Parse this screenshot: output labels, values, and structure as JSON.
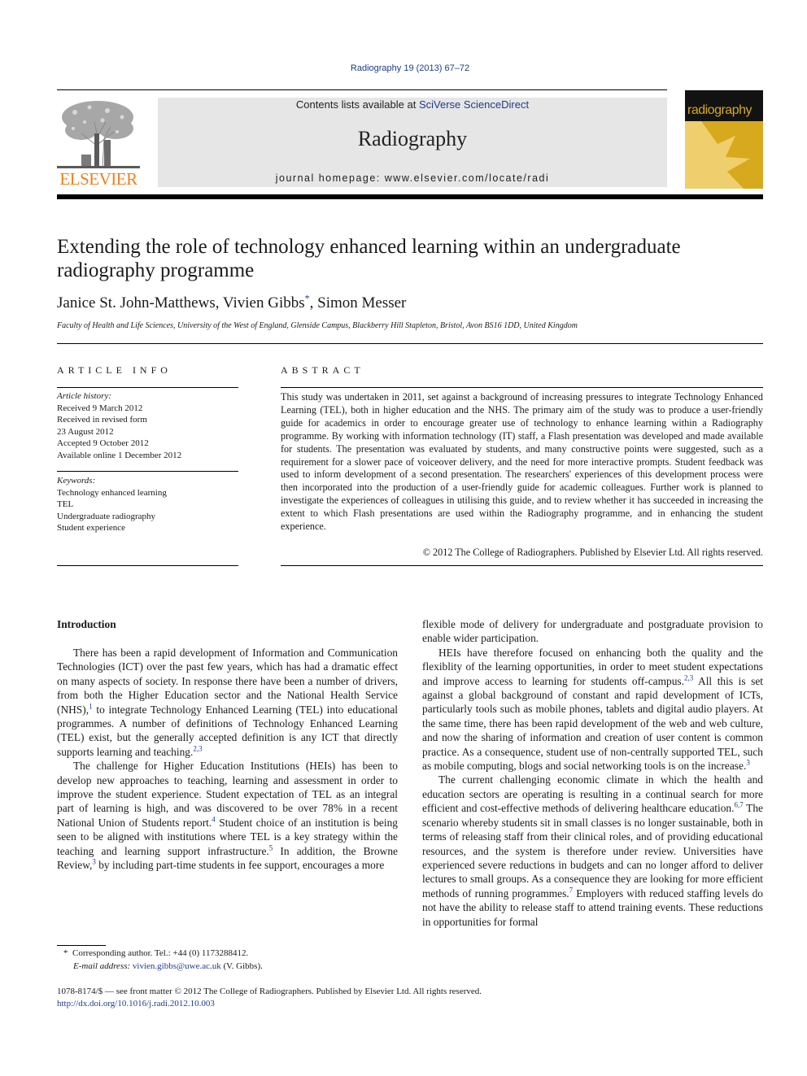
{
  "header": {
    "journal_reference": "Radiography 19 (2013) 67–72",
    "contents_prefix": "Contents lists available at ",
    "contents_link": "SciVerse ScienceDirect",
    "journal_name": "Radiography",
    "homepage_prefix": "journal homepage: ",
    "homepage_url": "www.elsevier.com/locate/radi",
    "publisher_logo_text": "ELSEVIER",
    "cover_title": "radiography",
    "colors": {
      "publisher_orange": "#f07f18",
      "link_blue": "#1f3c88",
      "cover_gold": "#d7a91c",
      "masthead_gray": "#e6e6e6"
    }
  },
  "article": {
    "title": "Extending the role of technology enhanced learning within an undergraduate radiography programme",
    "authors": [
      {
        "name": "Janice St. John-Matthews",
        "mark": ""
      },
      {
        "name": "Vivien Gibbs",
        "mark": "*"
      },
      {
        "name": "Simon Messer",
        "mark": ""
      }
    ],
    "affiliation": "Faculty of Health and Life Sciences, University of the West of England, Glenside Campus, Blackberry Hill Stapleton, Bristol, Avon BS16 1DD, United Kingdom"
  },
  "article_info": {
    "label": "ARTICLE INFO",
    "history_label": "Article history:",
    "history": [
      "Received 9 March 2012",
      "Received in revised form",
      "23 August 2012",
      "Accepted 9 October 2012",
      "Available online 1 December 2012"
    ],
    "keywords_label": "Keywords:",
    "keywords": [
      "Technology enhanced learning",
      "TEL",
      "Undergraduate radiography",
      "Student experience"
    ]
  },
  "abstract": {
    "label": "ABSTRACT",
    "text": "This study was undertaken in 2011, set against a background of increasing pressures to integrate Technology Enhanced Learning (TEL), both in higher education and the NHS. The primary aim of the study was to produce a user-friendly guide for academics in order to encourage greater use of technology to enhance learning within a Radiography programme. By working with information technology (IT) staff, a Flash presentation was developed and made available for students. The presentation was evaluated by students, and many constructive points were suggested, such as a requirement for a slower pace of voiceover delivery, and the need for more interactive prompts. Student feedback was used to inform development of a second presentation. The researchers' experiences of this development process were then incorporated into the production of a user-friendly guide for academic colleagues. Further work is planned to investigate the experiences of colleagues in utilising this guide, and to review whether it has succeeded in increasing the extent to which Flash presentations are used within the Radiography programme, and in enhancing the student experience.",
    "copyright": "© 2012 The College of Radiographers. Published by Elsevier Ltd. All rights reserved."
  },
  "body": {
    "section_heading": "Introduction",
    "left_paragraphs": [
      [
        {
          "t": "There has been a rapid development of Information and Communication Technologies (ICT) over the past few years, which has had a dramatic effect on many aspects of society. In response there have been a number of drivers, from both the Higher Education sector and the National Health Service (NHS),"
        },
        {
          "c": "1"
        },
        {
          "t": " to integrate Technology Enhanced Learning (TEL) into educational programmes. A number of definitions of Technology Enhanced Learning (TEL) exist, but the generally accepted definition is any ICT that directly supports learning and teaching."
        },
        {
          "c": "2,3"
        }
      ],
      [
        {
          "t": "The challenge for Higher Education Institutions (HEIs) has been to develop new approaches to teaching, learning and assessment in order to improve the student experience. Student expectation of TEL as an integral part of learning is high, and was discovered to be over 78% in a recent National Union of Students report."
        },
        {
          "c": "4"
        },
        {
          "t": " Student choice of an institution is being seen to be aligned with institutions where TEL is a key strategy within the teaching and learning support infrastructure."
        },
        {
          "c": "5"
        },
        {
          "t": " In addition, the Browne Review,"
        },
        {
          "c": "3"
        },
        {
          "t": " by including part-time students in fee support, encourages a more"
        }
      ]
    ],
    "right_paragraphs": [
      [
        {
          "t": "flexible mode of delivery for undergraduate and postgraduate provision to enable wider participation."
        }
      ],
      [
        {
          "t": "HEIs have therefore focused on enhancing both the quality and the flexiblity of the learning opportunities, in order to meet student expectations and improve access to learning for students off-campus."
        },
        {
          "c": "2,3"
        },
        {
          "t": " All this is set against a global background of constant and rapid development of ICTs, particularly tools such as mobile phones, tablets and digital audio players. At the same time, there has been rapid development of the web and web culture, and now the sharing of information and creation of user content is common practice. As a consequence, student use of non-centrally supported TEL, such as mobile computing, blogs and social networking tools is on the increase."
        },
        {
          "c": "3"
        }
      ],
      [
        {
          "t": "The current challenging economic climate in which the health and education sectors are operating is resulting in a continual search for more efficient and cost-effective methods of delivering healthcare education."
        },
        {
          "c": "6,7"
        },
        {
          "t": " The scenario whereby students sit in small classes is no longer sustainable, both in terms of releasing staff from their clinical roles, and of providing educational resources, and the system is therefore under review. Universities have experienced severe reductions in budgets and can no longer afford to deliver lectures to small groups. As a consequence they are looking for more efficient methods of running programmes."
        },
        {
          "c": "7"
        },
        {
          "t": " Employers with reduced staffing levels do not have the ability to release staff to attend training events. These reductions in opportunities for formal"
        }
      ]
    ]
  },
  "footnote": {
    "mark": "*",
    "corresponding": "Corresponding author. Tel.: +44 (0) 1173288412.",
    "email_label": "E-mail address:",
    "email": "vivien.gibbs@uwe.ac.uk",
    "email_suffix": " (V. Gibbs)."
  },
  "bottom": {
    "issn_line": "1078-8174/$ — see front matter © 2012 The College of Radiographers. Published by Elsevier Ltd. All rights reserved.",
    "doi": "http://dx.doi.org/10.1016/j.radi.2012.10.003"
  }
}
